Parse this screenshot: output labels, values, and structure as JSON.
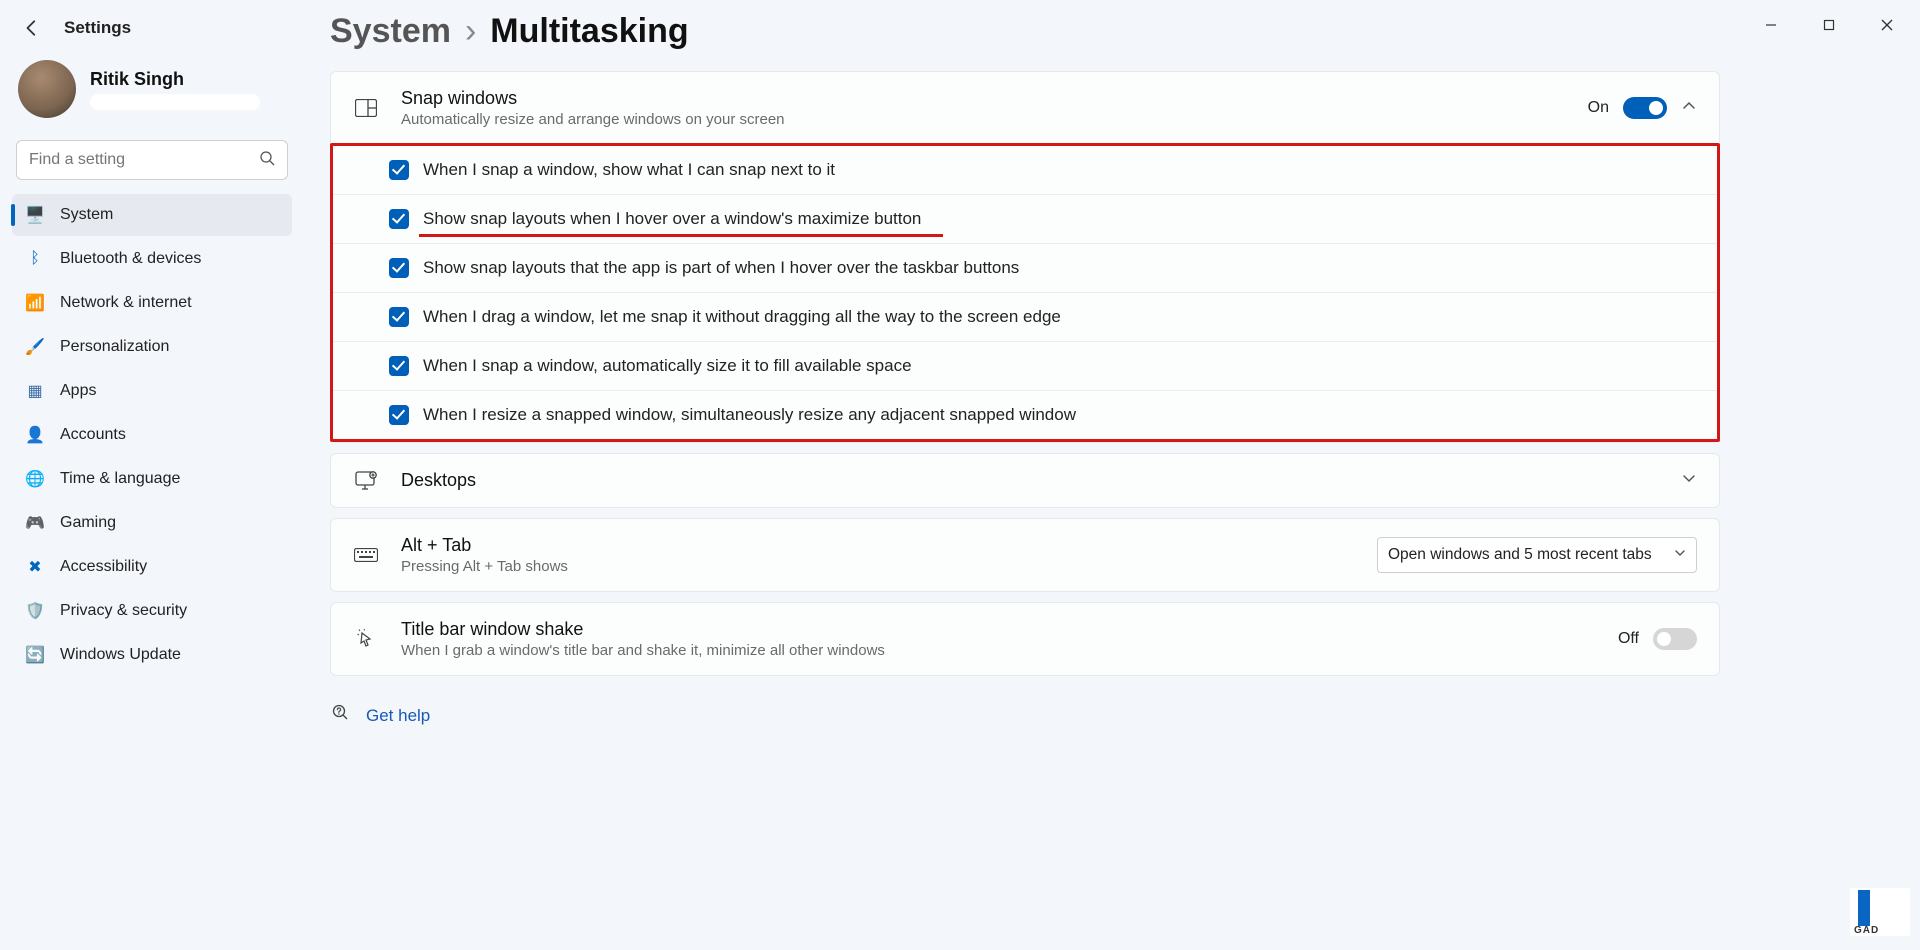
{
  "app_title": "Settings",
  "user": {
    "name": "Ritik Singh"
  },
  "search": {
    "placeholder": "Find a setting"
  },
  "nav": [
    {
      "label": "System",
      "icon": "🖥️",
      "active": true
    },
    {
      "label": "Bluetooth & devices",
      "icon": "ᛒ"
    },
    {
      "label": "Network & internet",
      "icon": "📶"
    },
    {
      "label": "Personalization",
      "icon": "🖌️"
    },
    {
      "label": "Apps",
      "icon": "▦"
    },
    {
      "label": "Accounts",
      "icon": "👤"
    },
    {
      "label": "Time & language",
      "icon": "🌐"
    },
    {
      "label": "Gaming",
      "icon": "🎮"
    },
    {
      "label": "Accessibility",
      "icon": "✖"
    },
    {
      "label": "Privacy & security",
      "icon": "🛡️"
    },
    {
      "label": "Windows Update",
      "icon": "🔄"
    }
  ],
  "breadcrumb": {
    "parent": "System",
    "current": "Multitasking"
  },
  "snap": {
    "title": "Snap windows",
    "subtitle": "Automatically resize and arrange windows on your screen",
    "state": "On",
    "options": [
      "When I snap a window, show what I can snap next to it",
      "Show snap layouts when I hover over a window's maximize button",
      "Show snap layouts that the app is part of when I hover over the taskbar buttons",
      "When I drag a window, let me snap it without dragging all the way to the screen edge",
      "When I snap a window, automatically size it to fill available space",
      "When I resize a snapped window, simultaneously resize any adjacent snapped window"
    ]
  },
  "desktops": {
    "title": "Desktops"
  },
  "alttab": {
    "title": "Alt + Tab",
    "subtitle": "Pressing Alt + Tab shows",
    "selected": "Open windows and 5 most recent tabs"
  },
  "shake": {
    "title": "Title bar window shake",
    "subtitle": "When I grab a window's title bar and shake it, minimize all other windows",
    "state": "Off"
  },
  "help_label": "Get help",
  "watermark": "GAD"
}
